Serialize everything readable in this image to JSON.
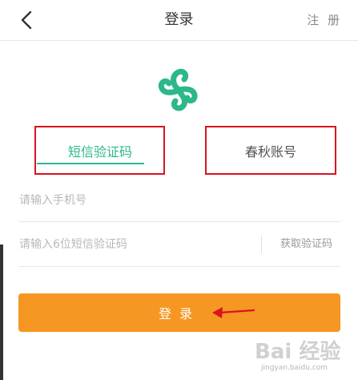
{
  "header": {
    "title": "登录",
    "register_label": "注 册",
    "back_icon": "chevron-left-icon"
  },
  "logo": {
    "icon": "chunqiu-logo-icon",
    "color": "#2bb88a"
  },
  "tabs": [
    {
      "label": "短信验证码",
      "active": true
    },
    {
      "label": "春秋账号",
      "active": false
    }
  ],
  "form": {
    "phone_placeholder": "请输入手机号",
    "code_placeholder": "请输入6位短信验证码",
    "get_code_label": "获取验证码"
  },
  "login_button": {
    "label": "登录",
    "color": "#f59722"
  },
  "annotation": {
    "box_color": "#d9141f",
    "arrow_color": "#d9141f"
  },
  "watermark": {
    "main": "Bai 经验",
    "sub": "jingyan.baidu.com"
  },
  "colors": {
    "accent": "#2bb88a",
    "button": "#f59722"
  }
}
